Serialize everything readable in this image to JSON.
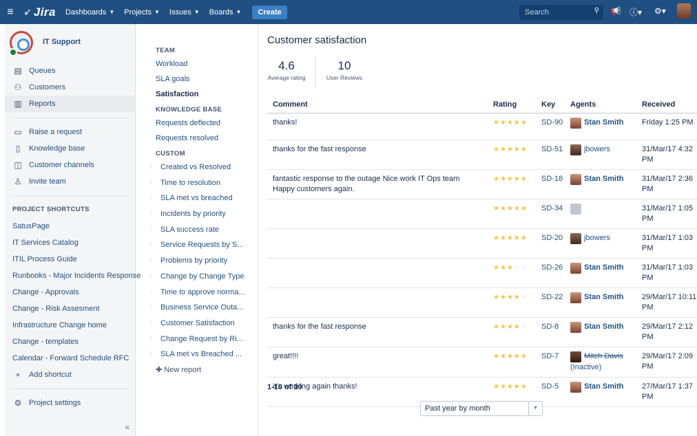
{
  "topnav": {
    "logo": "Jira",
    "items": [
      "Dashboards",
      "Projects",
      "Issues",
      "Boards"
    ],
    "create_label": "Create",
    "search_placeholder": "Search"
  },
  "sidebar": {
    "project_name": "IT Support",
    "main_items": [
      {
        "label": "Queues",
        "icon": "queues-icon"
      },
      {
        "label": "Customers",
        "icon": "customers-icon"
      },
      {
        "label": "Reports",
        "icon": "reports-icon",
        "active": true
      }
    ],
    "secondary_items": [
      {
        "label": "Raise a request",
        "icon": "raise-request-icon"
      },
      {
        "label": "Knowledge base",
        "icon": "knowledge-base-icon"
      },
      {
        "label": "Customer channels",
        "icon": "channels-icon"
      },
      {
        "label": "Invite team",
        "icon": "invite-icon"
      }
    ],
    "shortcuts_heading": "PROJECT SHORTCUTS",
    "shortcuts": [
      "SatusPage",
      "IT Services Catalog",
      "ITIL Process Guide",
      "Runbooks - Major Incidents Response",
      "Change - Approvals",
      "Change - Risk Assesment",
      "Infrastructure Change home",
      "Change - templates",
      "Calendar - Forward Schedule RFC"
    ],
    "add_shortcut": "Add shortcut",
    "project_settings": "Project settings",
    "collapse_glyph": "«"
  },
  "report_nav": {
    "team_heading": "TEAM",
    "team": [
      "Workload",
      "SLA goals",
      "Satisfaction"
    ],
    "kb_heading": "KNOWLEDGE BASE",
    "kb": [
      "Requests deflected",
      "Requests resolved"
    ],
    "custom_heading": "CUSTOM",
    "custom": [
      "Created vs Resolved",
      "Time to resolution",
      "SLA met vs breached",
      "Incidents by priority",
      "SLA success rate",
      "Service Requests by S...",
      "Problems by priority",
      "Change by Change Type",
      "Time to approve norma...",
      "Business Service Outa...",
      "Customer Satisfaction",
      "Change Request by Ri...",
      "SLA met vs Breached ..."
    ],
    "new_report": "New report"
  },
  "main": {
    "title": "Customer satisfaction",
    "avg_rating": "4.6",
    "avg_rating_label": "Average rating",
    "reviews": "10",
    "reviews_label": "User Reviews",
    "columns": [
      "Comment",
      "Rating",
      "Key",
      "Agents",
      "Received"
    ],
    "rows": [
      {
        "comment": "thanks!",
        "rating": 5,
        "key": "SD-90",
        "agent": "Stan Smith",
        "avatar": "stan",
        "received": "Friday 1:25 PM"
      },
      {
        "comment": "thanks for the fast response",
        "rating": 5,
        "key": "SD-51",
        "agent": "jbowers",
        "avatar": "jb",
        "received": "31/Mar/17 4:32 PM"
      },
      {
        "comment": "fantastic response to the outage Nice work IT Ops team Happy customers again.",
        "rating": 5,
        "key": "SD-18",
        "agent": "Stan Smith",
        "avatar": "stan",
        "received": "31/Mar/17 2:36 PM"
      },
      {
        "comment": "",
        "rating": 5,
        "key": "SD-34",
        "agent": "",
        "avatar": "gray",
        "received": "31/Mar/17 1:05 PM"
      },
      {
        "comment": "",
        "rating": 5,
        "key": "SD-20",
        "agent": "jbowers",
        "avatar": "jb",
        "received": "31/Mar/17 1:03 PM"
      },
      {
        "comment": "",
        "rating": 3,
        "key": "SD-26",
        "agent": "Stan Smith",
        "avatar": "stan",
        "received": "31/Mar/17 1:03 PM"
      },
      {
        "comment": "",
        "rating": 4,
        "key": "SD-22",
        "agent": "Stan Smith",
        "avatar": "stan",
        "received": "29/Mar/17 10:11 PM"
      },
      {
        "comment": "thanks for the fast response",
        "rating": 4,
        "key": "SD-8",
        "agent": "Stan Smith",
        "avatar": "stan",
        "received": "29/Mar/17 2:12 PM"
      },
      {
        "comment": "great!!!!",
        "rating": 5,
        "key": "SD-7",
        "agent": "Mitch Davis",
        "agent_suffix": "(Inactive)",
        "avatar": "mitch",
        "inactive": true,
        "received": "29/Mar/17 2:09 PM"
      },
      {
        "comment": "it's working again thanks!",
        "rating": 5,
        "key": "SD-5",
        "agent": "Stan Smith",
        "avatar": "stan",
        "received": "27/Mar/17 1:37 PM"
      }
    ],
    "count_label": "1-10 of 10",
    "period_select": "Past year by month"
  }
}
